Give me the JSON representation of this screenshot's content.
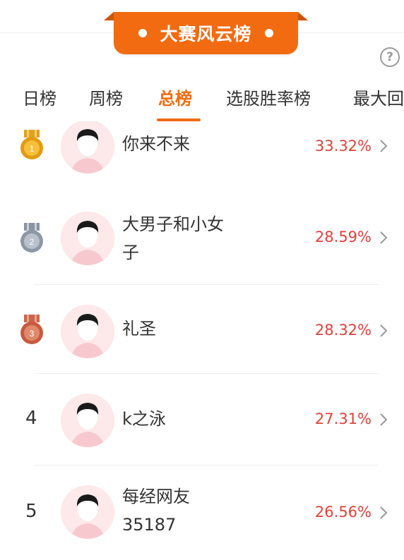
{
  "banner": {
    "title": "大赛风云榜"
  },
  "help_icon": "?",
  "tabs": [
    {
      "label": "日榜"
    },
    {
      "label": "周榜"
    },
    {
      "label": "总榜"
    },
    {
      "label": "选股胜率榜"
    },
    {
      "label": "最大回"
    }
  ],
  "active_tab": "总榜",
  "rows": [
    {
      "rank": "1",
      "medal": "gold",
      "name": "你来不来",
      "pct": "33.32%"
    },
    {
      "rank": "2",
      "medal": "silver",
      "name": "大男子和小女子",
      "pct": "28.59%"
    },
    {
      "rank": "3",
      "medal": "bronze",
      "name": "礼圣",
      "pct": "28.32%"
    },
    {
      "rank": "4",
      "name": "k之泳",
      "pct": "27.31%"
    },
    {
      "rank": "5",
      "name": "每经网友35187",
      "pct": "26.56%"
    }
  ],
  "colors": {
    "accent": "#f26b10",
    "percent": "#e0403a",
    "avatar_bg": "#fde8ea"
  }
}
